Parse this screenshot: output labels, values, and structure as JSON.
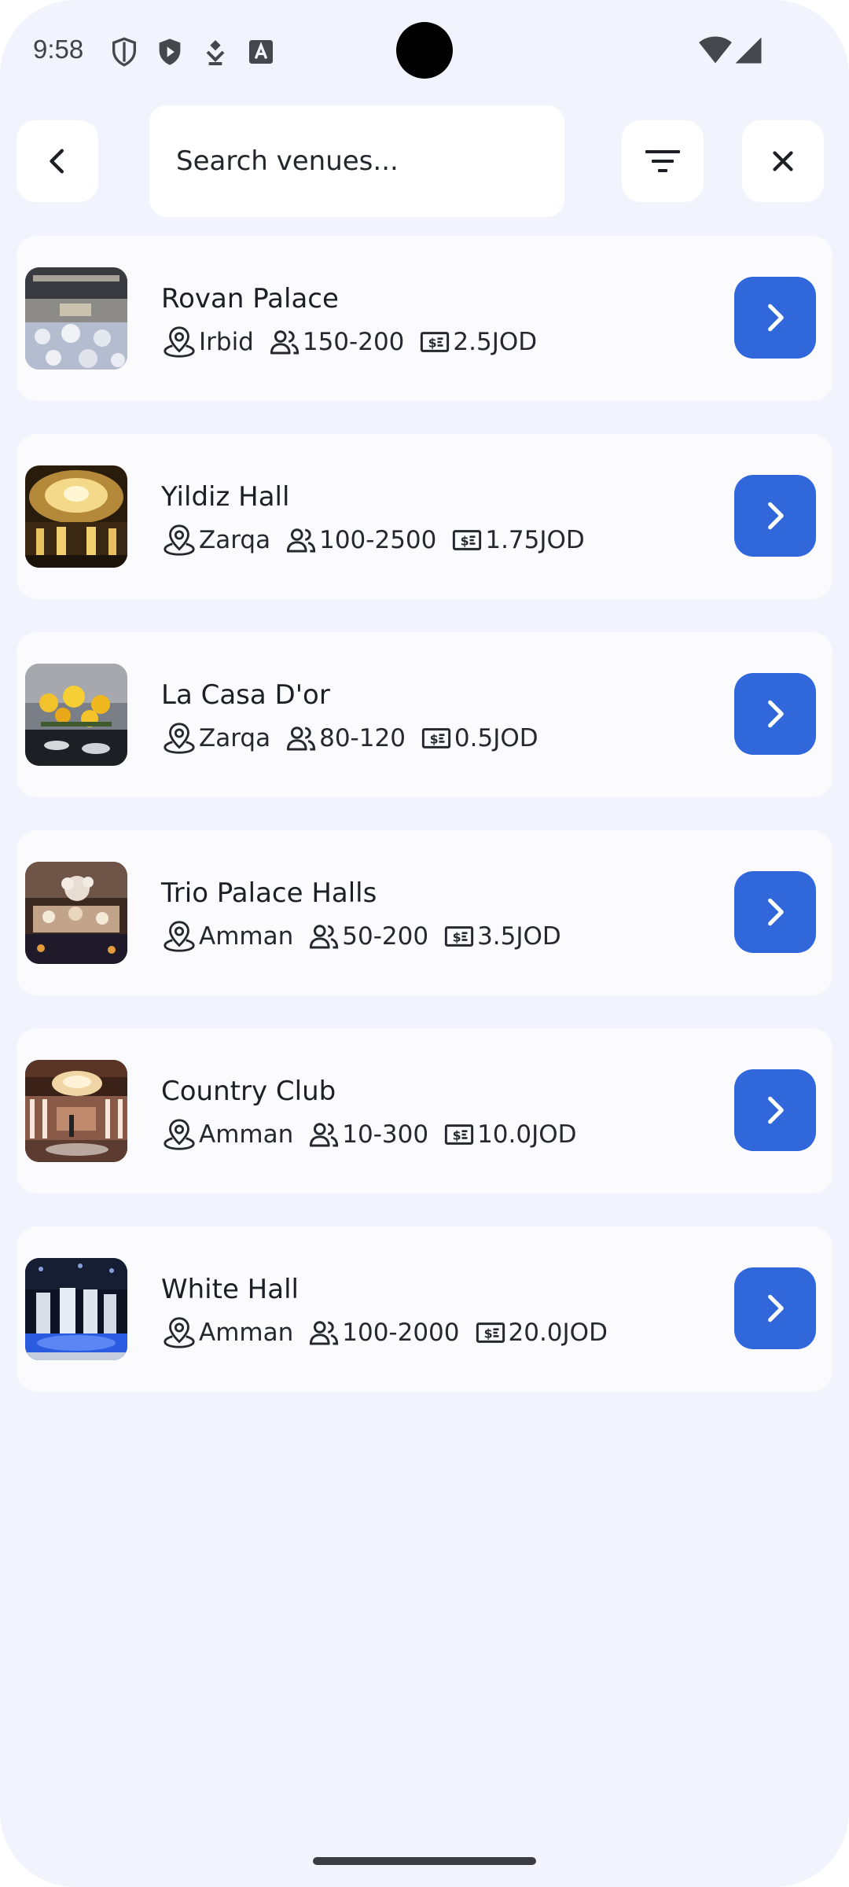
{
  "status_bar": {
    "time": "9:58",
    "left_icons": [
      "shield-outline-icon",
      "shield-play-icon",
      "download-arrow-icon",
      "text-a-icon"
    ],
    "right_icons": [
      "wifi-icon",
      "cellular-signal-icon"
    ]
  },
  "top_bar": {
    "back_icon": "arrow-back-icon",
    "search_placeholder": "Search venues...",
    "search_value": "",
    "filter_icon": "filter-lines-icon",
    "close_icon": "close-icon"
  },
  "venues": [
    {
      "name": "Rovan Palace",
      "city": "Irbid",
      "capacity": "150-200",
      "price": "2.5JOD",
      "photo": "banquet-hall-photo"
    },
    {
      "name": "Yildiz Hall",
      "city": "Zarqa",
      "capacity": "100-2500",
      "price": "1.75JOD",
      "photo": "golden-lights-hall-photo"
    },
    {
      "name": "La Casa D'or",
      "city": "Zarqa",
      "capacity": "80-120",
      "price": "0.5JOD",
      "photo": "sunflower-table-photo"
    },
    {
      "name": "Trio Palace Halls",
      "city": "Amman",
      "capacity": "50-200",
      "price": "3.5JOD",
      "photo": "dessert-table-photo"
    },
    {
      "name": "Country Club",
      "city": "Amman",
      "capacity": "10-300",
      "price": "10.0JOD",
      "photo": "chandelier-stage-photo"
    },
    {
      "name": "White Hall",
      "city": "Amman",
      "capacity": "100-2000",
      "price": "20.0JOD",
      "photo": "blue-lit-decor-photo"
    }
  ],
  "icons": {
    "location": "map-pin-icon",
    "capacity": "people-icon",
    "price": "cash-icon",
    "open": "chevron-right-icon"
  },
  "colors": {
    "background": "#f1f4fd",
    "card": "#fbfbfe",
    "accent": "#3068db",
    "text": "#1d1f24"
  }
}
